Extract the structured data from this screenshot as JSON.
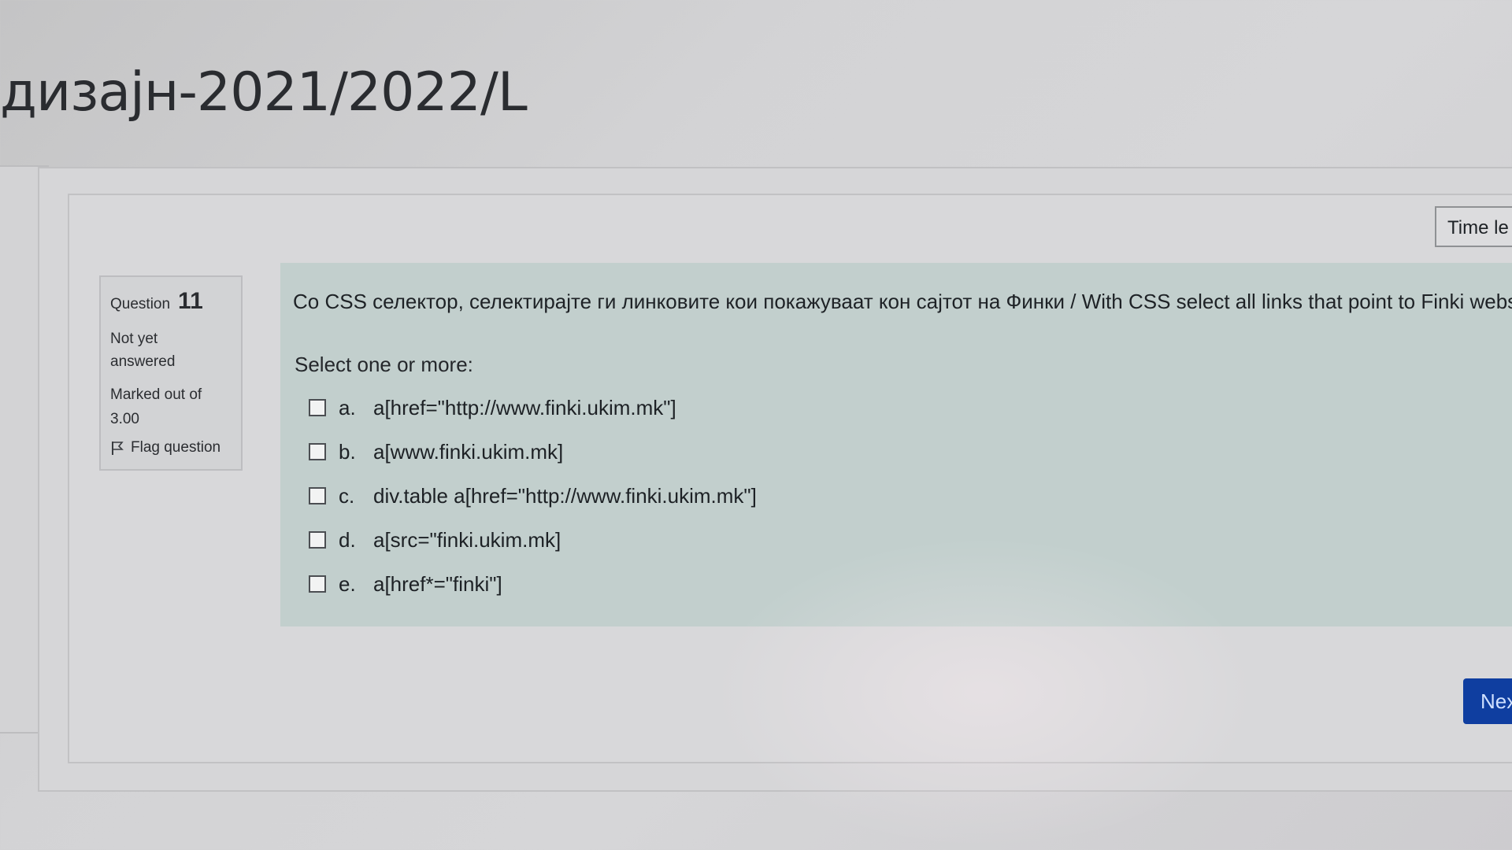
{
  "page": {
    "title": "дизајн-2021/2022/L"
  },
  "timer": {
    "label": "Time le"
  },
  "question_info": {
    "label": "Question",
    "number": "11",
    "state_line1": "Not yet",
    "state_line2": "answered",
    "grade_line1": "Marked out of",
    "grade_line2": "3.00",
    "flag_label": "Flag question"
  },
  "question": {
    "text": "Со CSS селектор, селектирајте ги линковите кои покажуваат кон сајтот на Финки / With CSS select all links that point to Finki website",
    "prompt": "Select one or more:",
    "answers": [
      {
        "letter": "a.",
        "text": "a[href=\"http://www.finki.ukim.mk\"]"
      },
      {
        "letter": "b.",
        "text": "a[www.finki.ukim.mk]"
      },
      {
        "letter": "c.",
        "text": "div.table a[href=\"http://www.finki.ukim.mk\"]"
      },
      {
        "letter": "d.",
        "text": "a[src=\"finki.ukim.mk]"
      },
      {
        "letter": "e.",
        "text": "a[href*=\"finki\"]"
      }
    ]
  },
  "navigation": {
    "next_label": "Nex"
  },
  "colors": {
    "formulation_bg": "#c2cfcd",
    "next_button": "#0f3ea0"
  }
}
